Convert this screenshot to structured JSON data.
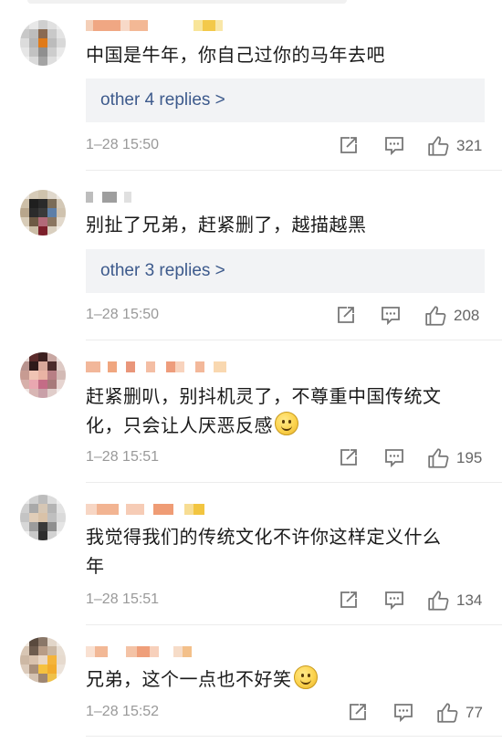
{
  "comments": [
    {
      "text": "中国是牛年，你自己过你的马年去吧",
      "replies_label": "other 4 replies >",
      "timestamp": "1–28 15:50",
      "likes": "321",
      "icons": [
        "share-icon",
        "comment-icon",
        "like-icon"
      ]
    },
    {
      "text": "别扯了兄弟，赶紧删了，越描越黑",
      "replies_label": "other 3 replies >",
      "timestamp": "1–28 15:50",
      "likes": "208",
      "icons": [
        "share-icon",
        "comment-icon",
        "like-icon"
      ]
    },
    {
      "text_line1": "赶紧删叭，别抖机灵了，不尊重中国传统文",
      "text_line2": "化，只会让人厌恶反感",
      "timestamp": "1–28 15:51",
      "likes": "195",
      "icons": [
        "share-icon",
        "comment-icon",
        "like-icon"
      ]
    },
    {
      "text_line1": "我觉得我们的传统文化不许你这样定义什么",
      "text_line2": "年",
      "timestamp": "1–28 15:51",
      "likes": "134",
      "icons": [
        "share-icon",
        "comment-icon",
        "like-icon"
      ]
    },
    {
      "text": "兄弟，这个一点也不好笑",
      "timestamp": "1–28 15:52",
      "likes": "77",
      "icons": [
        "share-icon",
        "comment-icon",
        "like-icon"
      ]
    }
  ],
  "colors": {
    "reply_link": "#3d5a8c",
    "reply_bg": "#f2f3f5",
    "meta_text": "#999999"
  }
}
